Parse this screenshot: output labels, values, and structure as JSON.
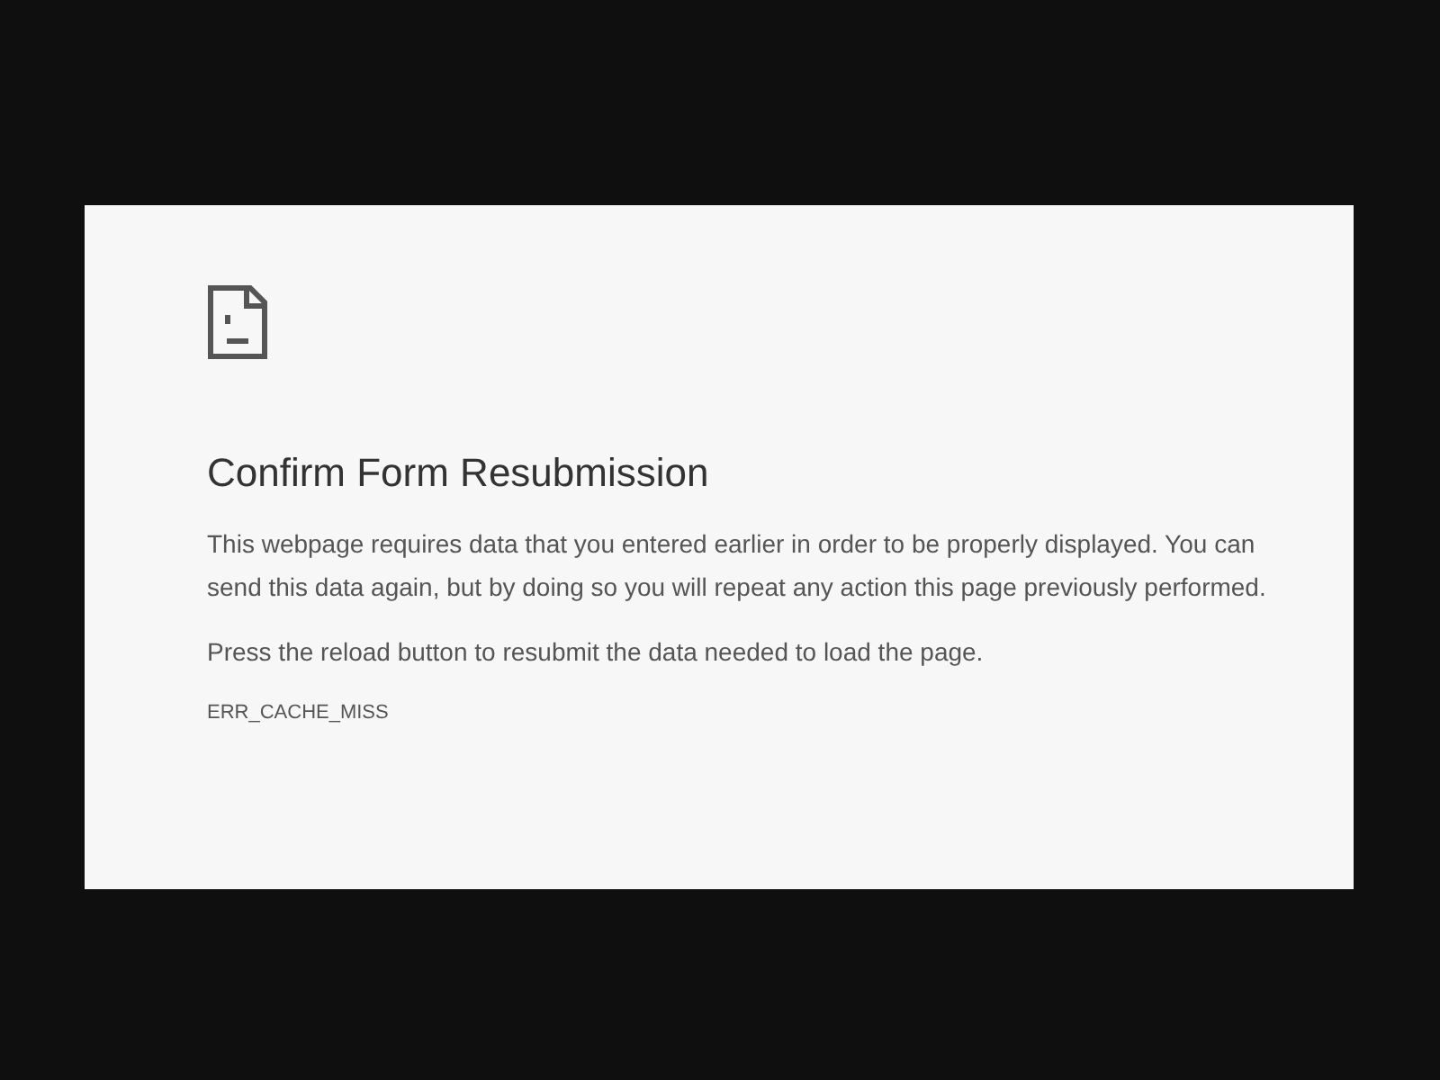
{
  "error_page": {
    "title": "Confirm Form Resubmission",
    "paragraphs": [
      "This webpage requires data that you entered earlier in order to be properly displayed. You can send this data again, but by doing so you will repeat any action this page previously performed.",
      "Press the reload button to resubmit the data needed to load the page."
    ],
    "error_code": "ERR_CACHE_MISS"
  }
}
